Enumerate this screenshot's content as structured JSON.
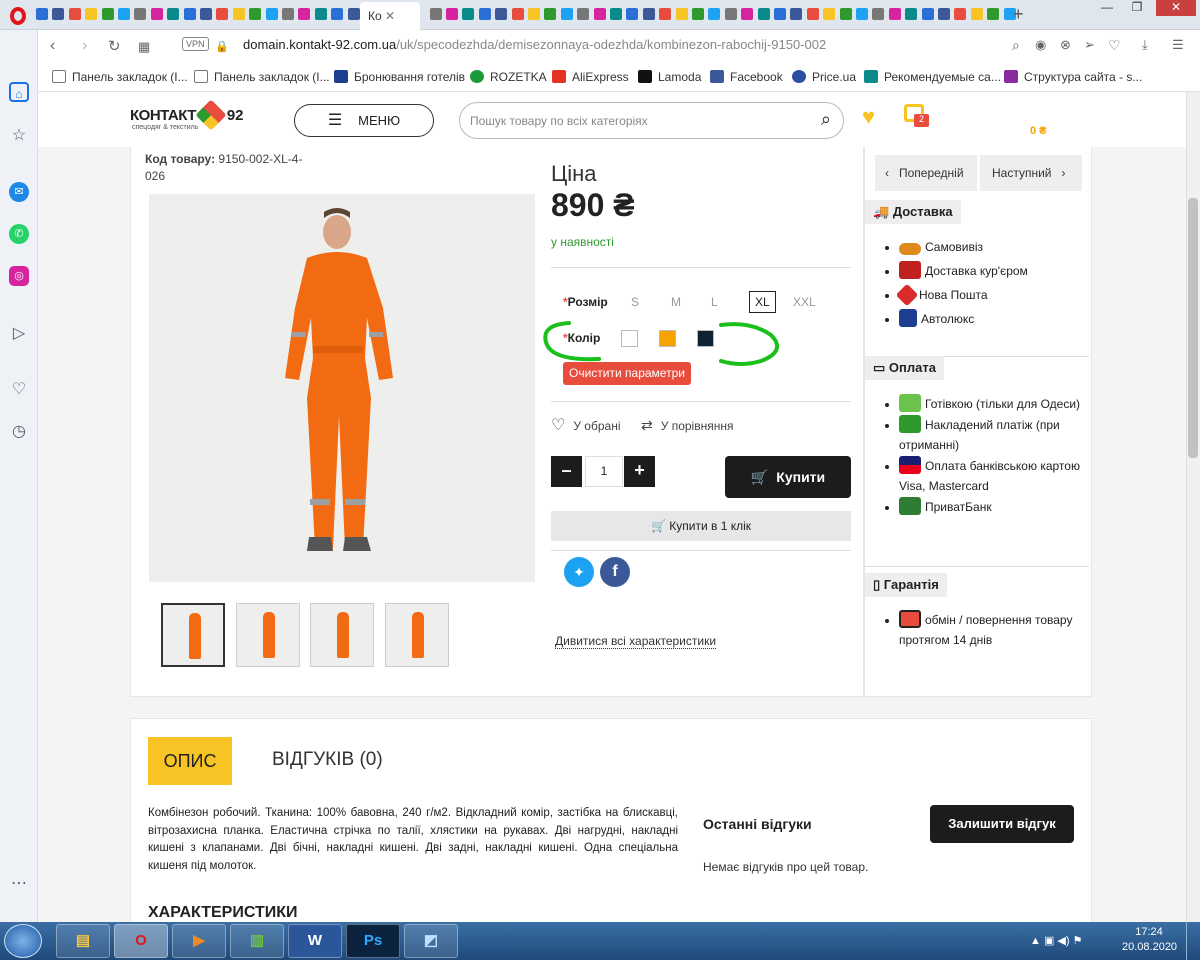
{
  "browser": {
    "active_tab_label": "Ко",
    "vpn_label": "VPN",
    "url_domain": "domain.kontakt-92.com.ua",
    "url_path": "/uk/specodezhda/demisezonnaya-odezhda/kombinezon-rabochij-9150-002",
    "bookmarks": [
      "Панель закладок (I...",
      "Панель закладок (I...",
      "Бронювання готелів",
      "ROZETKA",
      "AliExpress",
      "Lamoda",
      "Facebook",
      "Price.ua",
      "Рекомендуемые са...",
      "Структура сайта - s..."
    ]
  },
  "site": {
    "logo_main": "КОНТАКТ",
    "logo_num": "92",
    "logo_sub": "спецодяг & текстиль",
    "menu_label": "МЕНЮ",
    "search_placeholder": "Пошук товару по всіх категоріях",
    "cart_count": "2",
    "cart_total": "0 ₴"
  },
  "product": {
    "code_label": "Код товару:",
    "code_value": "9150-002-XL-4-026",
    "price_label": "Ціна",
    "price": "890 ₴",
    "availability": "у наявності",
    "size_label": "Розмір",
    "sizes": [
      "S",
      "M",
      "L",
      "XL",
      "XXL"
    ],
    "selected_size": "XL",
    "color_label": "Колір",
    "colors": [
      "#ffffff",
      "#f5a300",
      "#0f2233"
    ],
    "clear_params": "Очистити параметри",
    "wishlist": "У обрані",
    "compare": "У порівняння",
    "qty": "1",
    "buy": "Купити",
    "one_click": "Купити в 1 клік",
    "all_specs": "Дивитися всі характеристики"
  },
  "side": {
    "prev": "Попередній",
    "next": "Наступний",
    "delivery_title": "Доставка",
    "delivery": [
      "Самовивіз",
      "Доставка кур'єром",
      "Нова Пошта",
      "Автолюкс"
    ],
    "payment_title": "Оплата",
    "payment": [
      "Готівкою (тільки для Одеси)",
      "Накладений платіж (при отриманні)",
      "Оплата банківською картою Visa, Mastercard",
      "ПриватБанк"
    ],
    "guarantee_title": "Гарантія",
    "guarantee": "обмін / повернення товару протягом 14 днів"
  },
  "description": {
    "tab_desc": "ОПИС",
    "tab_reviews": "ВІДГУКІВ (0)",
    "text": "Комбінезон робочий. Тканина: 100% бавовна, 240 г/м2. Відкладний комір, застібка на блискавці, вітрозахисна планка. Еластична стрічка по талії, хлястики на рукавах. Дві нагрудні, накладні кишені з клапанами. Дві бічні, накладні кишені. Дві задні, накладні кишені. Одна спеціальна кишеня під молоток.",
    "reviews_title": "Останні відгуки",
    "no_reviews": "Немає відгуків про цей товар.",
    "leave_review": "Залишити відгук",
    "specs_title": "ХАРАКТЕРИСТИКИ"
  },
  "taskbar": {
    "time": "17:24",
    "date": "20.08.2020"
  },
  "colors": {
    "accent_yellow": "#f7c325",
    "clear_red": "#e84c3d",
    "annotation_green": "#1bbf1b",
    "stock_green": "#2e9a2e"
  }
}
